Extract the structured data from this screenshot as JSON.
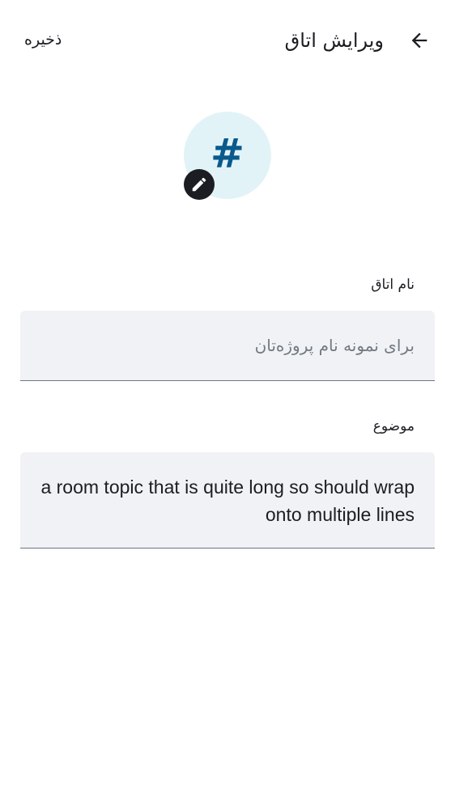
{
  "header": {
    "title": "ویرایش اتاق",
    "save_label": "ذخیره",
    "back_icon": "arrow-back-icon"
  },
  "avatar": {
    "glyph": "#",
    "background_color": "#e2f3f8",
    "glyph_color": "#0a5a8c",
    "edit_icon": "pencil-icon"
  },
  "form": {
    "name": {
      "label": "نام اتاق",
      "value": "",
      "placeholder": "برای نمونه نام پروژه‌تان"
    },
    "topic": {
      "label": "موضوع",
      "value": "a room topic that is quite long so should wrap onto multiple lines",
      "placeholder": ""
    }
  }
}
